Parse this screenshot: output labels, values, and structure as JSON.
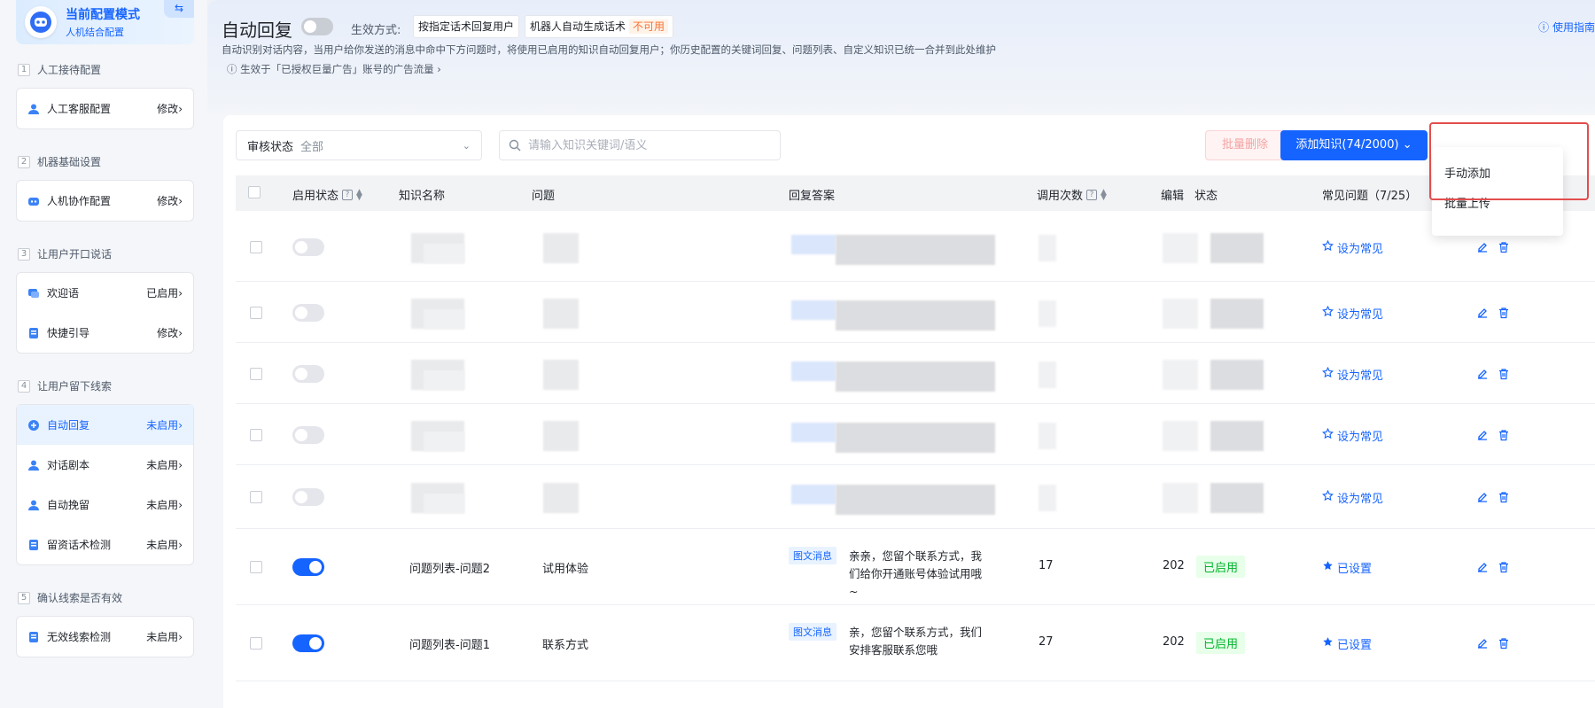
{
  "sidebar": {
    "mode_title": "当前配置模式",
    "mode_sub": "人机结合配置",
    "swap_icon": "⇆",
    "sections": [
      {
        "num": "1",
        "title": "人工接待配置",
        "items": [
          {
            "label": "人工客服配置",
            "status": "修改"
          }
        ]
      },
      {
        "num": "2",
        "title": "机器基础设置",
        "items": [
          {
            "label": "人机协作配置",
            "status": "修改"
          }
        ]
      },
      {
        "num": "3",
        "title": "让用户开口说话",
        "items": [
          {
            "label": "欢迎语",
            "status": "已启用"
          },
          {
            "label": "快捷引导",
            "status": "修改"
          }
        ]
      },
      {
        "num": "4",
        "title": "让用户留下线索",
        "items": [
          {
            "label": "自动回复",
            "status": "未启用"
          },
          {
            "label": "对话剧本",
            "status": "未启用"
          },
          {
            "label": "自动挽留",
            "status": "未启用"
          },
          {
            "label": "留资话术检测",
            "status": "未启用"
          }
        ]
      },
      {
        "num": "5",
        "title": "确认线索是否有效",
        "items": [
          {
            "label": "无效线索检测",
            "status": "未启用"
          }
        ]
      }
    ]
  },
  "header": {
    "title": "自动回复",
    "effect_label": "生效方式:",
    "option1": "按指定话术回复用户",
    "option2": "机器人自动生成话术",
    "option2_badge": "不可用",
    "description": "自动识别对话内容，当用户给你发送的消息中命中下方问题时，将使用已启用的知识自动回复用户；你历史配置的关键词回复、问题列表、自定义知识已统一合并到此处维护",
    "sub_description": "ⓘ 生效于「已授权巨量广告」账号的广告流量 ›",
    "guide": "ⓘ 使用指南"
  },
  "toolbar": {
    "filter_label": "审核状态",
    "filter_value": "全部",
    "search_placeholder": "请输入知识关键词/语义",
    "bulk_delete": "批量删除",
    "add_button": "添加知识(74/2000)"
  },
  "dropdown": {
    "items": [
      "手动添加",
      "批量上传"
    ]
  },
  "table": {
    "headers": [
      "启用状态",
      "知识名称",
      "问题",
      "回复答案",
      "调用次数",
      "编辑",
      "状态",
      "常见问题（7/25）"
    ],
    "rows": [
      {
        "enabled": false,
        "name": "",
        "question": "",
        "answer": "",
        "count": "",
        "edit": "",
        "status": "",
        "faq": "设为常见"
      },
      {
        "enabled": false,
        "name": "",
        "question": "",
        "answer": "",
        "count": "",
        "edit": "",
        "status": "",
        "faq": "设为常见"
      },
      {
        "enabled": false,
        "name": "",
        "question": "",
        "answer": "",
        "count": "",
        "edit": "",
        "status": "",
        "faq": "设为常见"
      },
      {
        "enabled": false,
        "name": "",
        "question": "",
        "answer": "",
        "count": "",
        "edit": "",
        "status": "",
        "faq": "设为常见"
      },
      {
        "enabled": false,
        "name": "",
        "question": "",
        "answer": "",
        "count": "",
        "edit": "",
        "status": "",
        "faq": "设为常见"
      },
      {
        "enabled": true,
        "name": "问题列表-问题2",
        "question": "试用体验",
        "msg_tag": "图文消息",
        "answer": "亲亲，您留个联系方式，我们给你开通账号体验试用哦~",
        "count": "17",
        "edit": "202",
        "status": "已启用",
        "faq": "已设置"
      },
      {
        "enabled": true,
        "name": "问题列表-问题1",
        "question": "联系方式",
        "msg_tag": "图文消息",
        "answer": "亲，您留个联系方式，我们安排客服联系您哦",
        "count": "27",
        "edit": "202",
        "status": "已启用",
        "faq": "已设置"
      }
    ]
  },
  "colors": {
    "primary": "#1664ff",
    "danger": "#e34d4d",
    "success": "#00b42a"
  }
}
